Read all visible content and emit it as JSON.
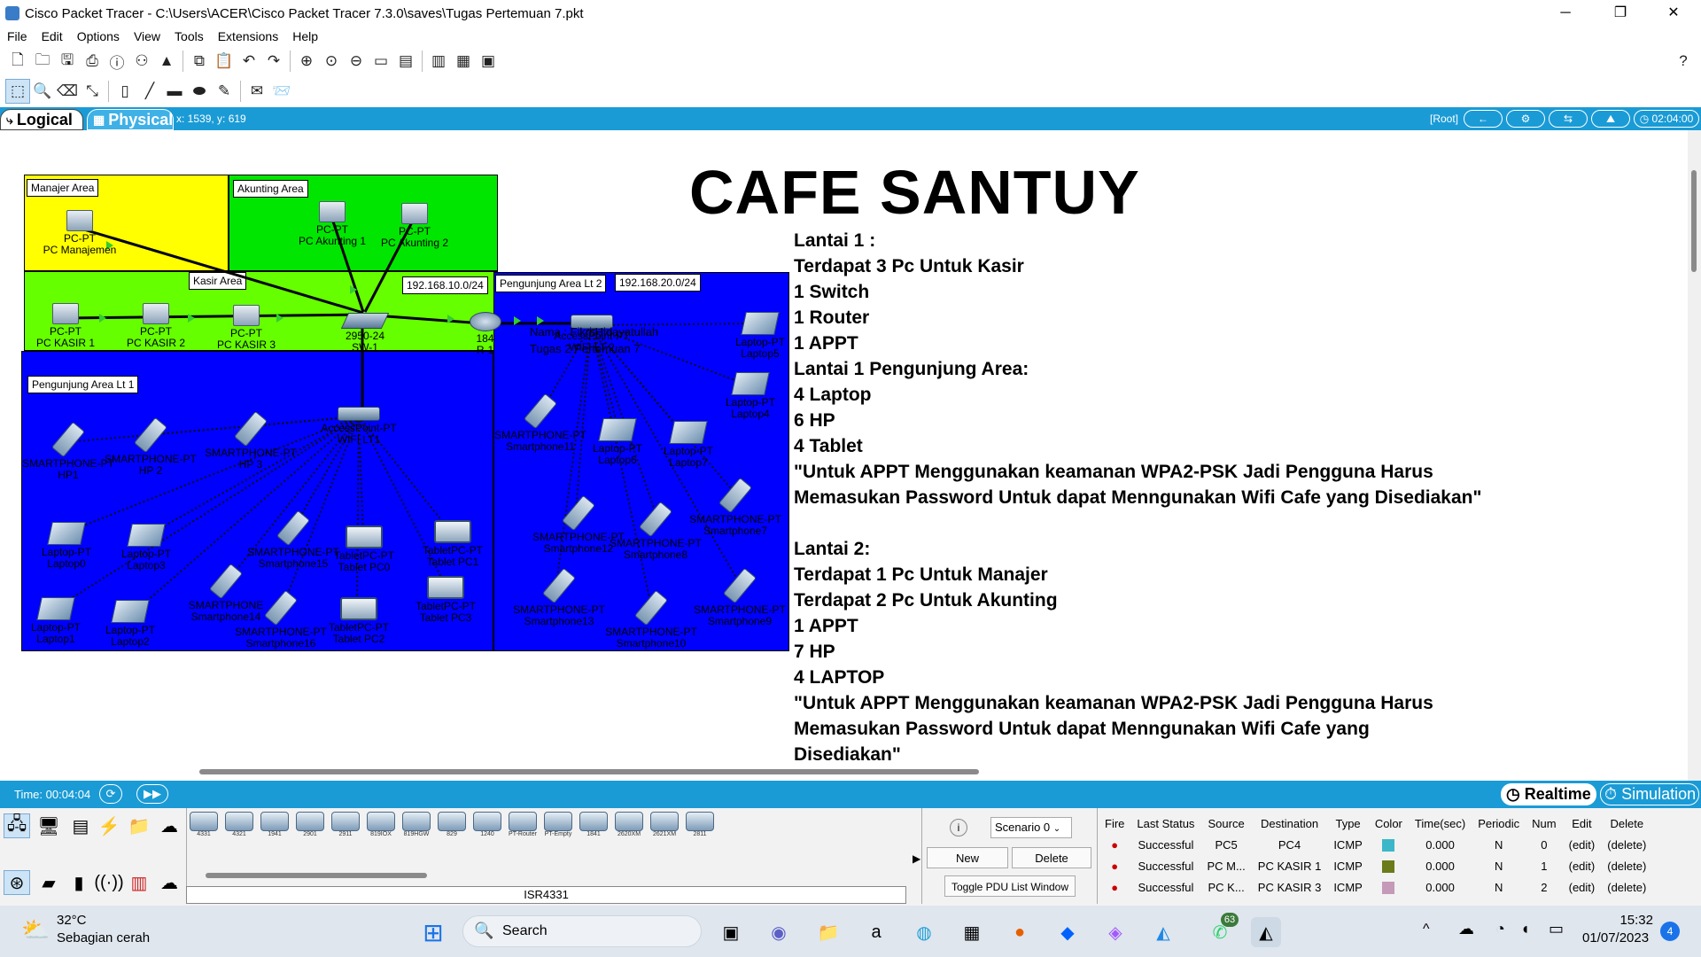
{
  "window": {
    "title": "Cisco Packet Tracer - C:\\Users\\ACER\\Cisco Packet Tracer 7.3.0\\saves\\Tugas Pertemuan 7.pkt",
    "minimize": "─",
    "maximize": "❐",
    "close": "✕"
  },
  "menu": [
    "File",
    "Edit",
    "Options",
    "View",
    "Tools",
    "Extensions",
    "Help"
  ],
  "help_icon": "?",
  "workspace_bar": {
    "logical": "Logical",
    "physical": "Physical",
    "coords": "x: 1539, y: 619",
    "root": "[Root]",
    "time": "02:04:00"
  },
  "areas": {
    "manajer": "Manajer Area",
    "akunting": "Akunting Area",
    "kasir": "Kasir Area",
    "pengunjung1": "Pengunjung Area Lt 1",
    "pengunjung2": "Pengunjung Area Lt 2"
  },
  "ips": {
    "net1": "192.168.10.0/24",
    "net2": "192.168.20.0/24"
  },
  "note": {
    "line1": "Nama : Fikri Hidayatullah",
    "line2": "Tugas 2 Pertemuan 7"
  },
  "title": "CAFE SANTUY",
  "description": [
    "Lantai 1  :",
    "Terdapat 3 Pc  Untuk Kasir",
    "1 Switch",
    "1 Router",
    "1 APPT",
    "Lantai 1 Pengunjung Area:",
    "4 Laptop",
    "6 HP",
    "4 Tablet",
    "\"Untuk APPT Menggunakan keamanan WPA2-PSK Jadi Pengguna Harus",
    "Memasukan Password Untuk dapat Menngunakan Wifi Cafe yang Disediakan\"",
    "",
    "Lantai 2:",
    "Terdapat 1 Pc Untuk Manajer",
    "Terdapat 2 Pc Untuk Akunting",
    "1 APPT",
    "7 HP",
    "4 LAPTOP",
    "\"Untuk APPT Menggunakan keamanan WPA2-PSK Jadi Pengguna Harus",
    "Memasukan Password Untuk dapat Menngunakan Wifi Cafe yang",
    "Disediakan\""
  ],
  "devices": {
    "pc_manajemen": [
      "PC-PT",
      "PC Manajemen"
    ],
    "pc_akunting1": [
      "PC-PT",
      "PC Akunting 1"
    ],
    "pc_akunting2": [
      "PC-PT",
      "PC Akunting 2"
    ],
    "pc_kasir1": [
      "PC-PT",
      "PC KASIR 1"
    ],
    "pc_kasir2": [
      "PC-PT",
      "PC KASIR 2"
    ],
    "pc_kasir3": [
      "PC-PT",
      "PC KASIR 3"
    ],
    "switch": [
      "2950-24",
      "SW-1"
    ],
    "router": [
      "184",
      "R-1"
    ],
    "ap1": [
      "AccessPoint-PT",
      "WIFI LT1"
    ],
    "ap2": [
      "AccessPoint-PT",
      "WIFI LT 2"
    ],
    "hp1": [
      "SMARTPHONE-PT",
      "HP1"
    ],
    "hp2": [
      "SMARTPHONE-PT",
      "HP 2"
    ],
    "hp3": [
      "SMARTPHONE-PT",
      "HP 3"
    ],
    "sp15": [
      "SMARTPHONE-PT",
      "Smartphone15"
    ],
    "sp14": [
      "SMARTPHONE",
      "Smartphone14"
    ],
    "sp16": [
      "SMARTPHONE-PT",
      "Smartphone16"
    ],
    "laptop0": [
      "Laptop-PT",
      "Laptop0"
    ],
    "laptop3": [
      "Laptop-PT",
      "Laptop3"
    ],
    "laptop1": [
      "Laptop-PT",
      "Laptop1"
    ],
    "laptop2": [
      "Laptop-PT",
      "Laptop2"
    ],
    "tablet0": [
      "TabletPC-PT",
      "Tablet PC0"
    ],
    "tablet1": [
      "TabletPC-PT",
      "Tablet PC1"
    ],
    "tablet3": [
      "TabletPC-PT",
      "Tablet PC3"
    ],
    "tablet2": [
      "TabletPC-PT",
      "Tablet PC2"
    ],
    "laptop5": [
      "Laptop-PT",
      "Laptop5"
    ],
    "laptop4": [
      "Laptop-PT",
      "Laptop4"
    ],
    "sp11": [
      "SMARTPHONE-PT",
      "Smartphone11"
    ],
    "laptop6": [
      "Laptop-PT",
      "Laptop6"
    ],
    "laptop7": [
      "Laptop-PT",
      "Laptop7"
    ],
    "sp7": [
      "SMARTPHONE-PT",
      "Smartphone7"
    ],
    "sp12": [
      "SMARTPHONE-PT",
      "Smartphone12"
    ],
    "sp8": [
      "SMARTPHONE-PT",
      "Smartphone8"
    ],
    "sp13": [
      "SMARTPHONE-PT",
      "Smartphone13"
    ],
    "sp10": [
      "SMARTPHONE-PT",
      "Smartphone10"
    ],
    "sp9": [
      "SMARTPHONE-PT",
      "Smartphone9"
    ]
  },
  "sim": {
    "time": "Time: 00:04:04",
    "realtime": "Realtime",
    "simulation": "Simulation"
  },
  "models": [
    "4331",
    "4321",
    "1941",
    "2901",
    "2911",
    "819IOX",
    "819HGW",
    "829",
    "1240",
    "PT-Router",
    "PT-Empty",
    "1841",
    "2620XM",
    "2621XM",
    "2811"
  ],
  "selected_model": "ISR4331",
  "scenario": {
    "value": "Scenario 0",
    "new": "New",
    "delete": "Delete",
    "toggle": "Toggle PDU List Window"
  },
  "pdu": {
    "headers": [
      "Fire",
      "Last Status",
      "Source",
      "Destination",
      "Type",
      "Color",
      "Time(sec)",
      "Periodic",
      "Num",
      "Edit",
      "Delete"
    ],
    "rows": [
      {
        "status": "Successful",
        "source": "PC5",
        "dest": "PC4",
        "type": "ICMP",
        "color": "#3bb7c9",
        "time": "0.000",
        "periodic": "N",
        "num": "0",
        "edit": "(edit)",
        "del": "(delete)"
      },
      {
        "status": "Successful",
        "source": "PC M...",
        "dest": "PC KASIR 1",
        "type": "ICMP",
        "color": "#6b7a1a",
        "time": "0.000",
        "periodic": "N",
        "num": "1",
        "edit": "(edit)",
        "del": "(delete)"
      },
      {
        "status": "Successful",
        "source": "PC K...",
        "dest": "PC KASIR 3",
        "type": "ICMP",
        "color": "#c59ab8",
        "time": "0.000",
        "periodic": "N",
        "num": "2",
        "edit": "(edit)",
        "del": "(delete)"
      }
    ]
  },
  "taskbar": {
    "temp": "32°C",
    "weather": "Sebagian cerah",
    "search": "Search",
    "whatsapp_badge": "63",
    "time": "15:32",
    "date": "01/07/2023",
    "notif": "4"
  }
}
